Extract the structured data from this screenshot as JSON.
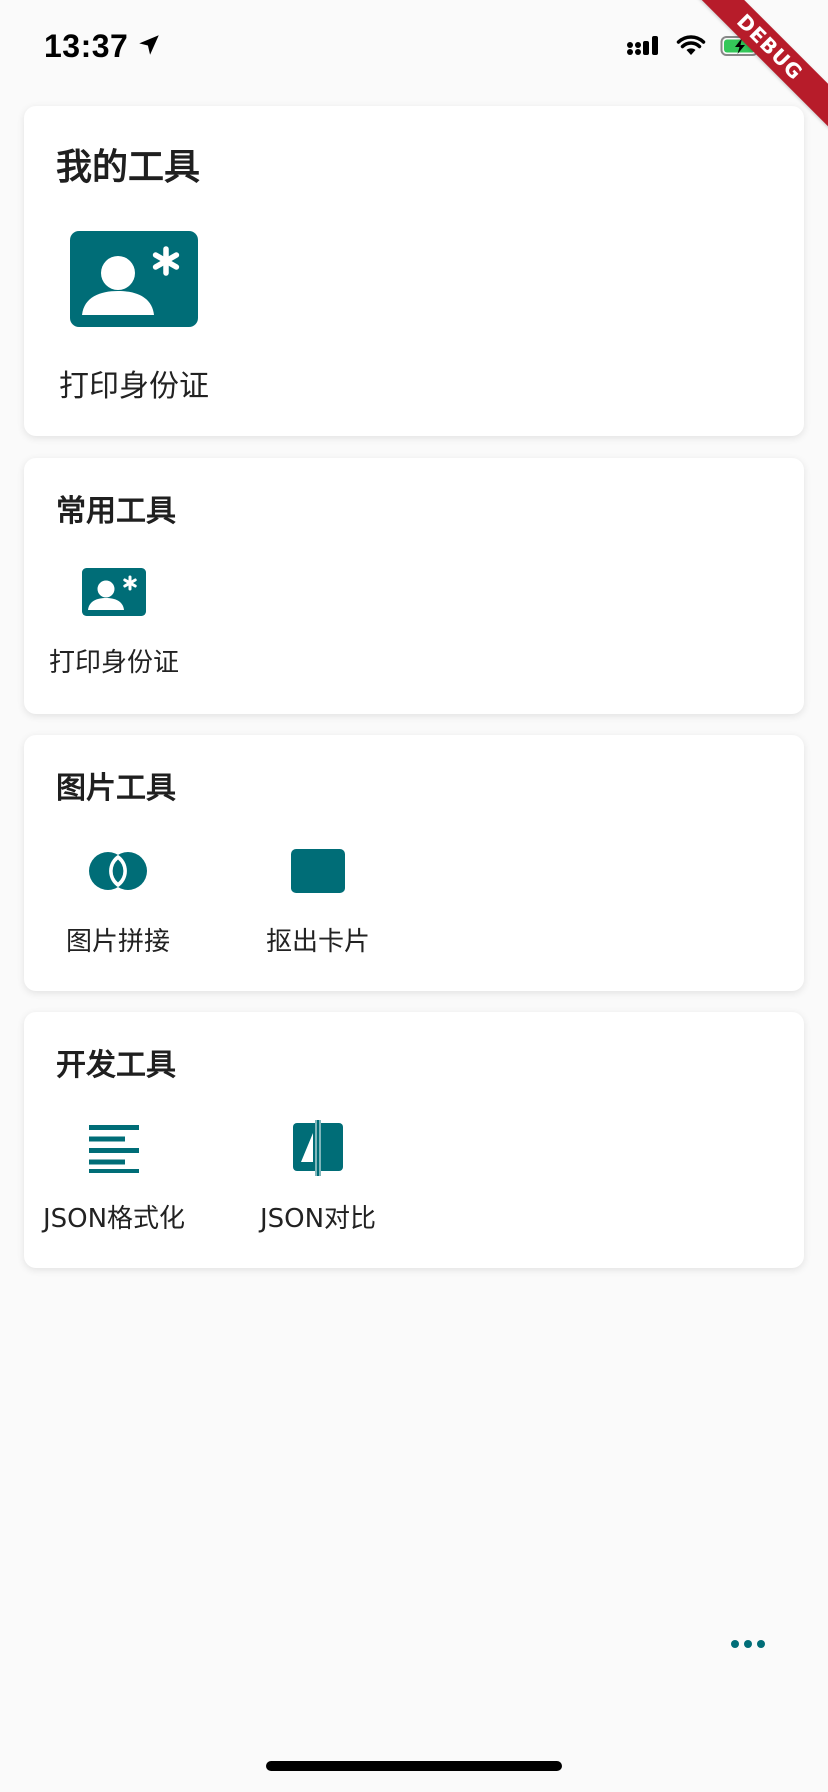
{
  "status_bar": {
    "time": "13:37",
    "icons": [
      "location-arrow-icon",
      "cellular-signal-icon",
      "wifi-icon",
      "battery-charging-icon"
    ]
  },
  "debug_banner": {
    "label": "DEBUG"
  },
  "colors": {
    "accent": "#006d77",
    "background": "#fafafa",
    "card": "#ffffff",
    "debug": "#b71c2a"
  },
  "sections": {
    "my_tools": {
      "title": "我的工具",
      "items": [
        {
          "label": "打印身份证",
          "icon": "id-card-icon"
        }
      ]
    },
    "common_tools": {
      "title": "常用工具",
      "items": [
        {
          "label": "打印身份证",
          "icon": "id-card-icon"
        }
      ]
    },
    "image_tools": {
      "title": "图片工具",
      "items": [
        {
          "label": "图片拼接",
          "icon": "image-merge-icon"
        },
        {
          "label": "抠出卡片",
          "icon": "card-crop-icon"
        }
      ]
    },
    "dev_tools": {
      "title": "开发工具",
      "items": [
        {
          "label": "JSON格式化",
          "icon": "format-align-icon"
        },
        {
          "label": "JSON对比",
          "icon": "compare-icon"
        }
      ]
    }
  },
  "more_button": {
    "icon": "more-horiz-icon"
  }
}
